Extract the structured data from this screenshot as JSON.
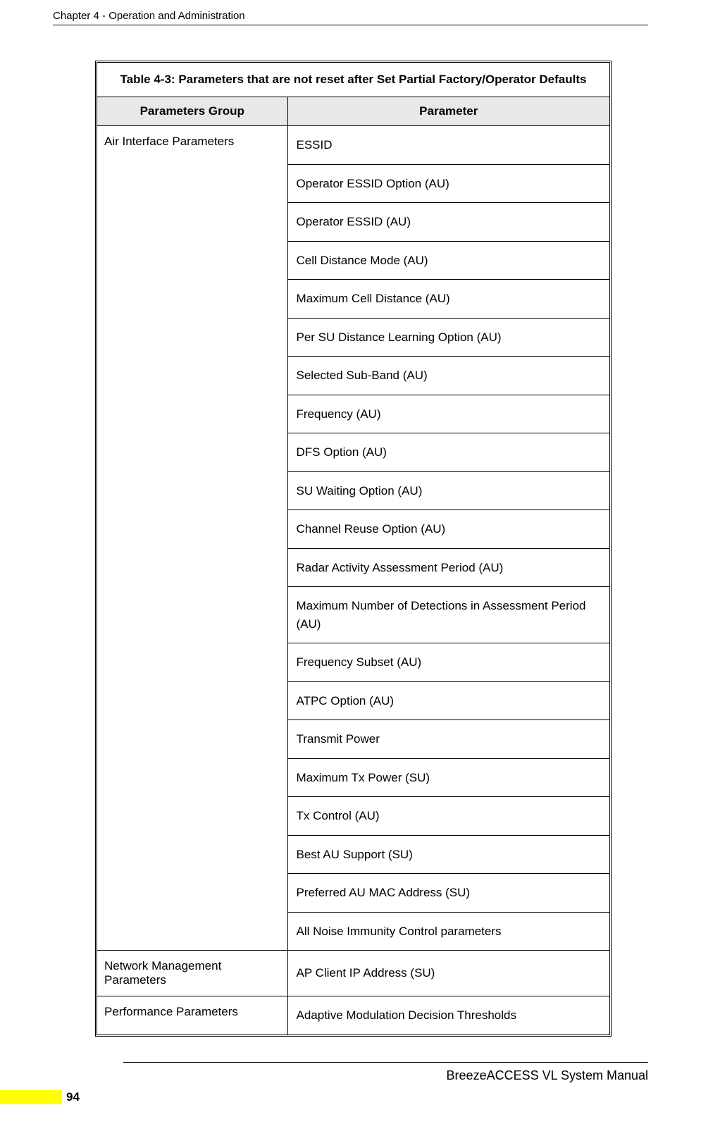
{
  "header": {
    "chapter": "Chapter 4 - Operation and Administration"
  },
  "table": {
    "caption": "Table 4-3: Parameters that are not reset after Set Partial Factory/Operator Defaults",
    "col_group": "Parameters Group",
    "col_param": "Parameter",
    "groups": [
      {
        "name": "Air Interface Parameters",
        "params": [
          "ESSID",
          "Operator ESSID Option (AU)",
          "Operator ESSID (AU)",
          "Cell Distance Mode (AU)",
          "Maximum Cell Distance (AU)",
          "Per SU Distance Learning Option (AU)",
          "Selected Sub-Band (AU)",
          "Frequency (AU)",
          "DFS Option (AU)",
          "SU Waiting Option (AU)",
          "Channel Reuse Option (AU)",
          "Radar Activity Assessment Period (AU)",
          "Maximum Number of Detections in Assessment Period (AU)",
          "Frequency Subset (AU)",
          "ATPC Option (AU)",
          "Transmit Power",
          "Maximum Tx Power (SU)",
          "Tx Control (AU)",
          "Best AU Support (SU)",
          "Preferred AU MAC Address (SU)",
          "All Noise Immunity Control parameters"
        ]
      },
      {
        "name": "Network Management Parameters",
        "params": [
          "AP Client IP Address (SU)"
        ]
      },
      {
        "name": "Performance Parameters",
        "params": [
          "Adaptive Modulation Decision Thresholds"
        ]
      }
    ]
  },
  "footer": {
    "manual": "BreezeACCESS VL System Manual",
    "page": "94"
  }
}
